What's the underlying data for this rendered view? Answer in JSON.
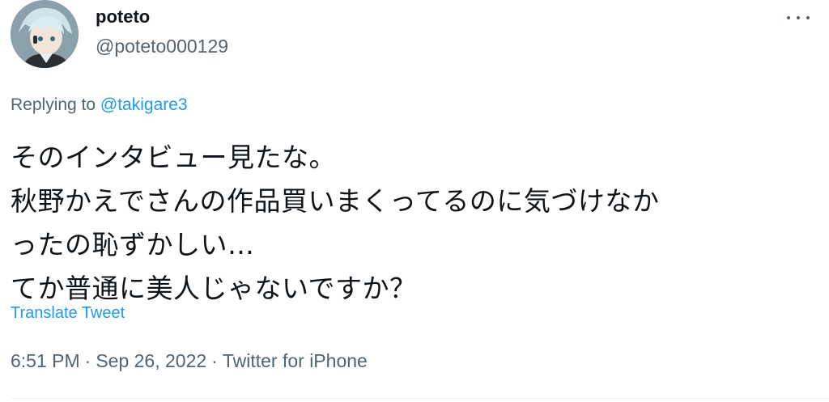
{
  "author": {
    "display_name": "poteto",
    "handle": "@poteto000129",
    "avatar_icon": "avatar-image"
  },
  "more_menu_icon": "more-horizontal-icon",
  "reply_context": {
    "prefix": "Replying to",
    "mention": "@takigare3"
  },
  "tweet_text": {
    "lines": [
      "そのインタビュー見たな。",
      "秋野かえでさんの作品買いまくってるのに気づけなか",
      "ったの恥ずかしい…",
      "てか普通に美人じゃないですか？"
    ]
  },
  "translate_label": "Translate Tweet",
  "meta": {
    "time": "6:51 PM",
    "separator": "·",
    "date": "Sep 26, 2022",
    "source": "Twitter for iPhone"
  },
  "colors": {
    "text_primary": "#0f1419",
    "text_secondary": "#536471",
    "accent": "#1d9bf0"
  }
}
